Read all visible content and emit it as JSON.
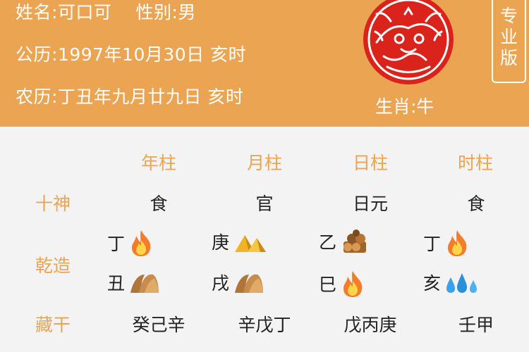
{
  "header": {
    "name_line": "姓名:可口可",
    "gender_line": "性别:男",
    "solar_line": "公历:1997年10月30日 亥时",
    "lunar_line": "农历:丁丑年九月廿九日 亥时",
    "zodiac_label": "生肖:牛",
    "pro_button": [
      "专",
      "业",
      "版"
    ]
  },
  "columns": [
    "年柱",
    "月柱",
    "日柱",
    "时柱"
  ],
  "rows": {
    "shishen": {
      "label": "十神",
      "values": [
        "食",
        "官",
        "日元",
        "食"
      ]
    },
    "qianzao": {
      "label": "乾造",
      "stems": [
        {
          "char": "丁",
          "element_icon": "fire-icon"
        },
        {
          "char": "庚",
          "element_icon": "metal-icon"
        },
        {
          "char": "乙",
          "element_icon": "wood-icon"
        },
        {
          "char": "丁",
          "element_icon": "fire-icon"
        }
      ],
      "branches": [
        {
          "char": "丑",
          "element_icon": "earth-icon"
        },
        {
          "char": "戌",
          "element_icon": "earth-icon"
        },
        {
          "char": "巳",
          "element_icon": "fire-icon"
        },
        {
          "char": "亥",
          "element_icon": "water-icon"
        }
      ]
    },
    "canggan": {
      "label": "藏干",
      "values": [
        "癸己辛",
        "辛戊丁",
        "戊丙庚",
        "壬甲"
      ]
    }
  },
  "colors": {
    "header_bg": "#eaa452",
    "label_color": "#eaa452",
    "body_bg": "#f3f3f3",
    "seal_red": "#d9231b"
  }
}
